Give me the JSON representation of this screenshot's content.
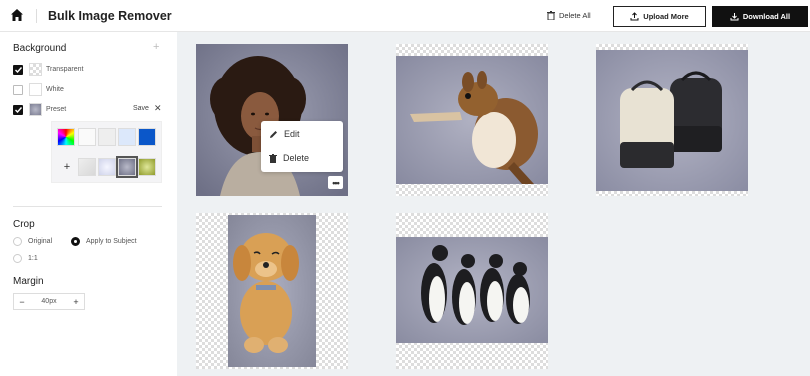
{
  "header": {
    "title": "Bulk Image Remover",
    "delete_all": "Delete All",
    "upload_more": "Upload More",
    "download_all": "Download All"
  },
  "sidebar": {
    "background": {
      "title": "Background",
      "add": "+",
      "options": [
        {
          "label": "Transparent",
          "checked": true
        },
        {
          "label": "White",
          "checked": false
        },
        {
          "label": "Preset",
          "checked": true
        }
      ],
      "save": "Save",
      "close": "✕",
      "palette_add": "+"
    },
    "crop": {
      "title": "Crop",
      "options": [
        {
          "label": "Original",
          "selected": false
        },
        {
          "label": "Apply to Subject",
          "selected": true
        },
        {
          "label": "1:1",
          "selected": false
        }
      ]
    },
    "margin": {
      "title": "Margin",
      "minus": "−",
      "value": "40px",
      "plus": "+"
    }
  },
  "context_menu": {
    "items": [
      {
        "label": "Edit",
        "icon": "pencil-icon"
      },
      {
        "label": "Delete",
        "icon": "trash-icon"
      }
    ],
    "more": "•••"
  },
  "cards": [
    {
      "subject": "girl-portrait"
    },
    {
      "subject": "squirrel"
    },
    {
      "subject": "backpacks"
    },
    {
      "subject": "puppy"
    },
    {
      "subject": "penguins"
    }
  ],
  "colors": {
    "accent": "#111111",
    "preset_bg": "#8e90a6",
    "main_bg": "#eef1f3"
  }
}
